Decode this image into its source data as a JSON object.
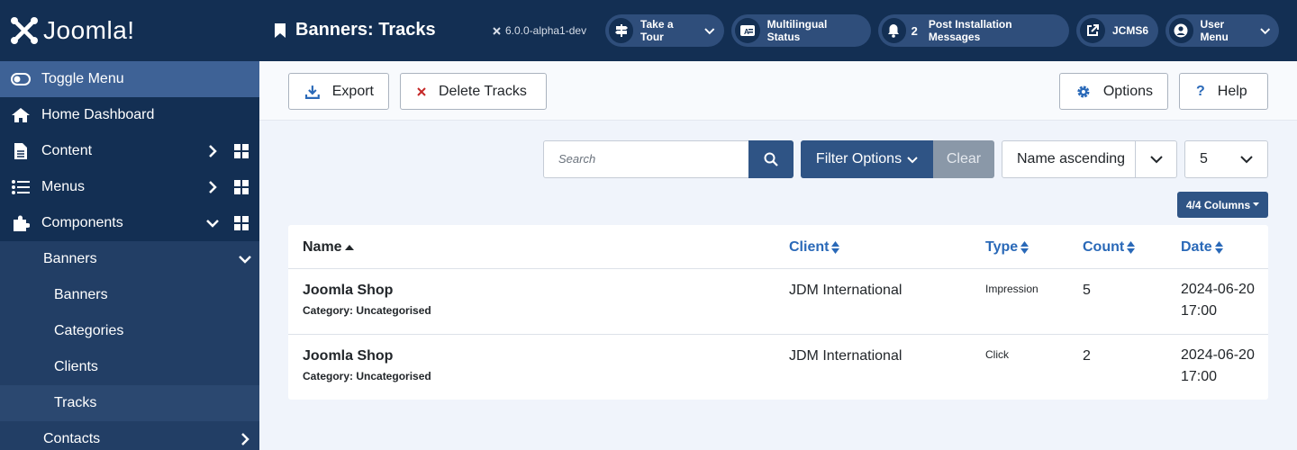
{
  "sidebar": {
    "logo": "Joomla!",
    "toggle": "Toggle Menu",
    "items": [
      {
        "label": "Home Dashboard"
      },
      {
        "label": "Content"
      },
      {
        "label": "Menus"
      },
      {
        "label": "Components"
      }
    ],
    "banners_group": "Banners",
    "sub_items": [
      {
        "label": "Banners"
      },
      {
        "label": "Categories"
      },
      {
        "label": "Clients"
      },
      {
        "label": "Tracks"
      }
    ],
    "contacts": "Contacts"
  },
  "header": {
    "title": "Banners: Tracks",
    "version": "6.0.0-alpha1-dev",
    "tour": "Take a Tour",
    "multilingual": "Multilingual Status",
    "notification_count": "2",
    "post_install": "Post Installation Messages",
    "site": "JCMS6",
    "user": "User Menu"
  },
  "toolbar": {
    "export": "Export",
    "delete": "Delete Tracks",
    "options": "Options",
    "help": "Help"
  },
  "filters": {
    "search_placeholder": "Search",
    "filter_options": "Filter Options",
    "clear": "Clear",
    "ordering": "Name ascending",
    "limit": "5",
    "columns": "4/4 Columns"
  },
  "table": {
    "columns": [
      "Name",
      "Client",
      "Type",
      "Count",
      "Date"
    ],
    "rows": [
      {
        "name": "Joomla Shop",
        "category": "Category: Uncategorised",
        "client": "JDM International",
        "type": "Impression",
        "count": "5",
        "date1": "2024-06-20",
        "date2": "17:00"
      },
      {
        "name": "Joomla Shop",
        "category": "Category: Uncategorised",
        "client": "JDM International",
        "type": "Click",
        "count": "2",
        "date1": "2024-06-20",
        "date2": "17:00"
      }
    ]
  },
  "colors": {
    "sidebar": "#132f53",
    "accent": "#2f5485",
    "link": "#2a69b8"
  }
}
